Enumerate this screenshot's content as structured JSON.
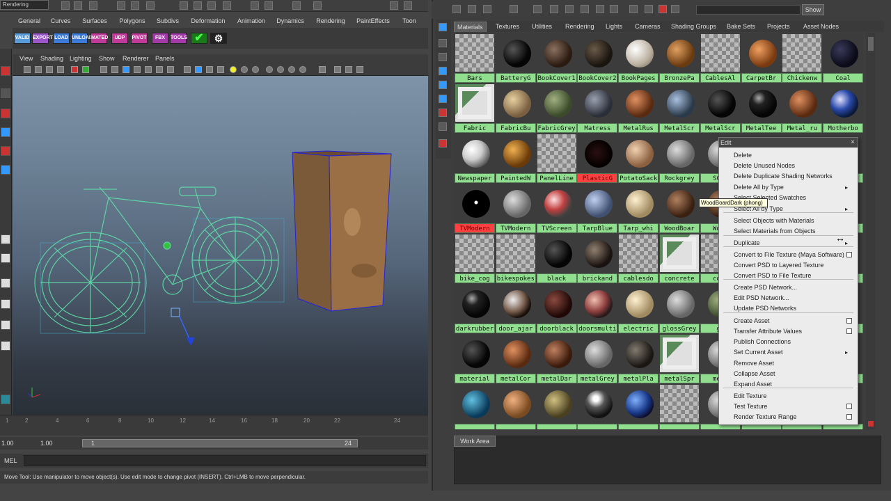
{
  "workspace_menu": "Rendering",
  "shelf_tabs": [
    "General",
    "Curves",
    "Surfaces",
    "Polygons",
    "Subdivs",
    "Deformation",
    "Animation",
    "Dynamics",
    "Rendering",
    "PaintEffects",
    "Toon"
  ],
  "shelf_buttons": [
    {
      "label": "VALID",
      "color": "#5a9ad6"
    },
    {
      "label": "EXPORT",
      "color": "#9a56c8"
    },
    {
      "label": "LOAD",
      "color": "#3c7ad8"
    },
    {
      "label": "UNLOAD",
      "color": "#3c7ad8"
    },
    {
      "label": "MATED",
      "color": "#c03a9a"
    },
    {
      "label": "UDP",
      "color": "#c03a9a"
    },
    {
      "label": "PIVOT",
      "color": "#c03a9a"
    },
    {
      "label": "FBX",
      "color": "#a23aa8"
    },
    {
      "label": "TOOLS",
      "color": "#a23aa8"
    }
  ],
  "viewport_menu": [
    "View",
    "Shading",
    "Lighting",
    "Show",
    "Renderer",
    "Panels"
  ],
  "timeline_ticks": [
    "1",
    "2",
    "4",
    "6",
    "8",
    "10",
    "12",
    "14",
    "16",
    "18",
    "20",
    "22",
    "24"
  ],
  "range": {
    "start": "1.00",
    "start2": "1.00",
    "current": "1",
    "end": "24"
  },
  "mel_label": "MEL",
  "help_text": "Move Tool: Use manipulator to move object(s). Use edit mode to change pivot (INSERT). Ctrl+LMB to move perpendicular.",
  "hypershade": {
    "show_button": "Show",
    "tabs": [
      "Materials",
      "Textures",
      "Utilities",
      "Rendering",
      "Lights",
      "Cameras",
      "Shading Groups",
      "Bake Sets",
      "Projects",
      "Asset Nodes"
    ],
    "active_tab": "Materials",
    "work_area_label": "Work Area",
    "swatches": [
      [
        {
          "n": "Bars",
          "t": "checker"
        },
        {
          "n": "BatteryG",
          "t": "black"
        },
        {
          "n": "BookCover1",
          "t": "darkbrown"
        },
        {
          "n": "BookCover2",
          "t": "darkbrown2"
        },
        {
          "n": "BookPages",
          "t": "cream"
        },
        {
          "n": "BronzePa",
          "t": "bronze"
        },
        {
          "n": "CablesAl",
          "t": "checker"
        },
        {
          "n": "CarpetBr",
          "t": "orange"
        },
        {
          "n": "Chickenw",
          "t": "checker"
        },
        {
          "n": "Coal",
          "t": "navy"
        }
      ],
      [
        {
          "n": "Fabric",
          "t": "image"
        },
        {
          "n": "FabricBu",
          "t": "tan"
        },
        {
          "n": "FabricGrey",
          "t": "green"
        },
        {
          "n": "Matress",
          "t": "stripe"
        },
        {
          "n": "MetalRus",
          "t": "rust"
        },
        {
          "n": "MetalScr",
          "t": "steel"
        },
        {
          "n": "MetalScr",
          "t": "black"
        },
        {
          "n": "MetalTee",
          "t": "blackshine"
        },
        {
          "n": "Metal_ru",
          "t": "rust"
        },
        {
          "n": "Motherbo",
          "t": "blue"
        }
      ],
      [
        {
          "n": "Newspaper",
          "t": "white"
        },
        {
          "n": "PaintedW",
          "t": "gold"
        },
        {
          "n": "PanelLine",
          "t": "checker"
        },
        {
          "n": "PlasticG",
          "t": "darkred",
          "red": true
        },
        {
          "n": "PotatoSack",
          "t": "burlap"
        },
        {
          "n": "Rockgrey",
          "t": "grey"
        },
        {
          "n": "SCAL",
          "t": "grey"
        },
        {
          "n": "",
          "t": "grey"
        },
        {
          "n": "",
          "t": "grey"
        },
        {
          "n": "",
          "t": "grey"
        }
      ],
      [
        {
          "n": "TVModern",
          "t": "dot",
          "red": true
        },
        {
          "n": "TVModern",
          "t": "grey"
        },
        {
          "n": "TVScreen",
          "t": "marble"
        },
        {
          "n": "TarpBlue",
          "t": "bluegrey"
        },
        {
          "n": "Tarp_whi",
          "t": "beige"
        },
        {
          "n": "WoodBoar",
          "t": "wood"
        },
        {
          "n": "Wood",
          "t": "wood"
        },
        {
          "n": "",
          "t": "grey"
        },
        {
          "n": "",
          "t": "grey"
        },
        {
          "n": "",
          "t": "grey"
        }
      ],
      [
        {
          "n": "bike_cog",
          "t": "checker"
        },
        {
          "n": "bikespokes",
          "t": "checker"
        },
        {
          "n": "black",
          "t": "black"
        },
        {
          "n": "brickand",
          "t": "brick"
        },
        {
          "n": "cablesdo",
          "t": "checker"
        },
        {
          "n": "concrete",
          "t": "image"
        },
        {
          "n": "conc",
          "t": "checker"
        },
        {
          "n": "",
          "t": "grey"
        },
        {
          "n": "",
          "t": "grey"
        },
        {
          "n": "",
          "t": "grey"
        }
      ],
      [
        {
          "n": "darkrubber",
          "t": "blackshine"
        },
        {
          "n": "door_ajar",
          "t": "door"
        },
        {
          "n": "doorblack",
          "t": "darkred2"
        },
        {
          "n": "doorsmulti",
          "t": "marble2"
        },
        {
          "n": "electric",
          "t": "beige"
        },
        {
          "n": "glossGrey",
          "t": "grey"
        },
        {
          "n": "gl",
          "t": "green"
        },
        {
          "n": "",
          "t": "grey"
        },
        {
          "n": "",
          "t": "grey"
        },
        {
          "n": "",
          "t": "grey"
        }
      ],
      [
        {
          "n": "material",
          "t": "black"
        },
        {
          "n": "metalCor",
          "t": "rust"
        },
        {
          "n": "metalDar",
          "t": "rust2"
        },
        {
          "n": "metalGrey",
          "t": "grey"
        },
        {
          "n": "metalPla",
          "t": "darkmetal"
        },
        {
          "n": "metalSpr",
          "t": "image"
        },
        {
          "n": "meta",
          "t": "grey"
        },
        {
          "n": "",
          "t": "grey"
        },
        {
          "n": "",
          "t": "grey"
        },
        {
          "n": "",
          "t": "grey"
        }
      ],
      [
        {
          "n": "",
          "t": "teal"
        },
        {
          "n": "",
          "t": "wood2"
        },
        {
          "n": "",
          "t": "olive"
        },
        {
          "n": "",
          "t": "chrome"
        },
        {
          "n": "",
          "t": "earth"
        },
        {
          "n": "",
          "t": "checker"
        },
        {
          "n": "",
          "t": "grey"
        },
        {
          "n": "",
          "t": "grey"
        },
        {
          "n": "",
          "t": "grey"
        },
        {
          "n": "",
          "t": "grey"
        }
      ]
    ]
  },
  "tooltip": "WoodBoardDark (phong)",
  "context_menu": {
    "header": "Edit",
    "items": [
      {
        "label": "Delete"
      },
      {
        "label": "Delete Unused Nodes"
      },
      {
        "label": "Delete Duplicate Shading Networks"
      },
      {
        "label": "Delete All by Type",
        "sub": true
      },
      {
        "label": "Select Selected Swatches",
        "covered": true
      },
      {
        "label": "Select All by Type",
        "sub": true
      },
      {
        "label": "Select Objects with Materials"
      },
      {
        "label": "Select Materials from Objects"
      },
      {
        "label": "Duplicate",
        "sub": true
      },
      {
        "label": "Convert to File Texture (Maya Software)",
        "opt": true
      },
      {
        "label": "Convert PSD to Layered Texture"
      },
      {
        "label": "Convert PSD to File Texture"
      },
      {
        "label": "Create PSD Network..."
      },
      {
        "label": "Edit PSD Network..."
      },
      {
        "label": "Update PSD Networks"
      },
      {
        "label": "Create Asset",
        "opt": true
      },
      {
        "label": "Transfer Attribute Values",
        "opt": true
      },
      {
        "label": "Publish Connections"
      },
      {
        "label": "Set Current Asset",
        "sub": true
      },
      {
        "label": "Remove Asset"
      },
      {
        "label": "Collapse Asset"
      },
      {
        "label": "Expand Asset"
      },
      {
        "label": "Edit Texture"
      },
      {
        "label": "Test Texture",
        "opt": true
      },
      {
        "label": "Render Texture Range",
        "opt": true
      }
    ]
  }
}
